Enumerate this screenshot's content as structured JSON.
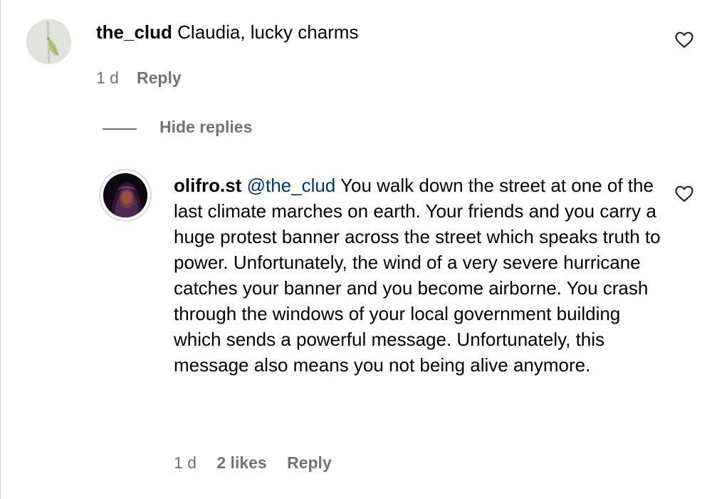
{
  "comment": {
    "username": "the_clud",
    "text": "Claudia, lucky charms",
    "time": "1 d",
    "reply_label": "Reply",
    "like_icon": "heart-outline-icon"
  },
  "thread": {
    "hide_replies_label": "Hide replies"
  },
  "reply": {
    "username": "olifro.st",
    "mention": "@the_clud",
    "text": "You walk down the street at one of the last climate marches on earth. Your friends and you carry a huge protest banner across the street which speaks truth to power. Unfortunately, the wind of a very severe hurricane catches your banner and you become airborne. You crash through the windows of your local government building which sends a powerful message. Unfortunately, this message also means you not being alive anymore.",
    "time": "1 d",
    "likes": "2 likes",
    "reply_label": "Reply",
    "like_icon": "heart-outline-icon"
  },
  "colors": {
    "text": "#000000",
    "secondary": "#737373",
    "mention": "#00376b",
    "background": "#ffffff"
  }
}
